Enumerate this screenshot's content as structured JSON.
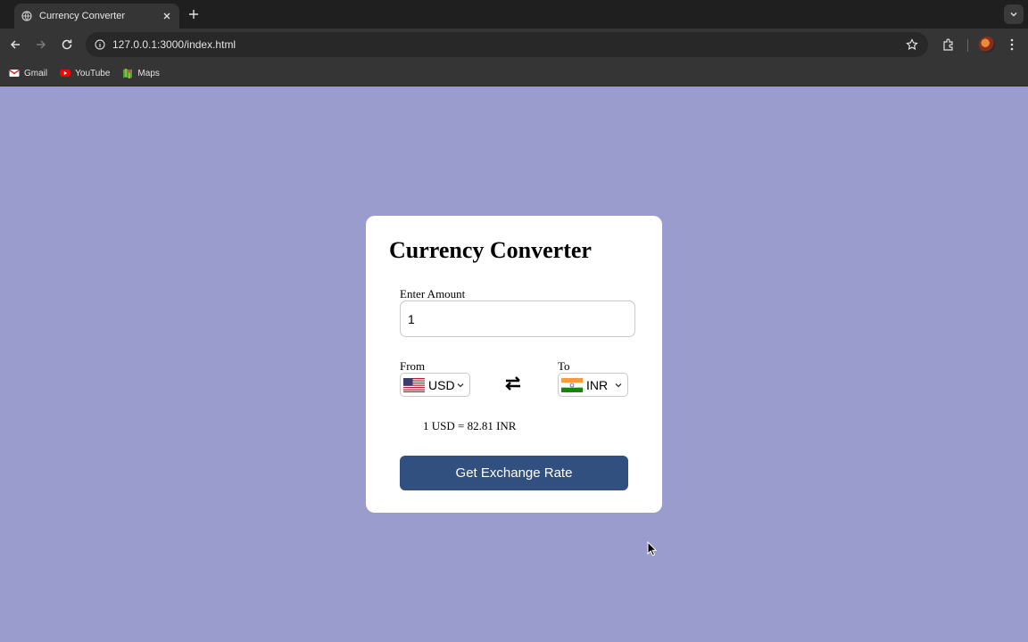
{
  "browser": {
    "tab_title": "Currency Converter",
    "url": "127.0.0.1:3000/index.html",
    "bookmarks": [
      {
        "label": "Gmail",
        "icon": "gmail-icon"
      },
      {
        "label": "YouTube",
        "icon": "youtube-icon"
      },
      {
        "label": "Maps",
        "icon": "maps-icon"
      }
    ]
  },
  "app": {
    "title": "Currency Converter",
    "amount_label": "Enter Amount",
    "amount_value": "1",
    "from_label": "From",
    "from_currency": "USD",
    "to_label": "To",
    "to_currency": "INR",
    "rate_text": "1 USD = 82.81 INR",
    "button_label": "Get Exchange Rate"
  },
  "colors": {
    "page_background": "#9a9ccd",
    "button": "#32507f",
    "card": "#ffffff"
  }
}
